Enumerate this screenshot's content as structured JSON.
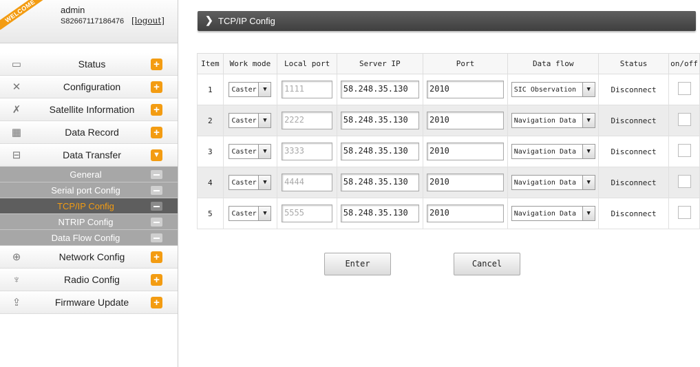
{
  "user": {
    "welcome": "WELCOME",
    "name": "admin",
    "serial": "S82667117186476",
    "logout": "[logout]"
  },
  "nav_top": [
    {
      "label": "Status",
      "icon": "monitor-icon",
      "glyph": "▭"
    },
    {
      "label": "Configuration",
      "icon": "tools-icon",
      "glyph": "✕"
    },
    {
      "label": "Satellite Information",
      "icon": "satellite-icon",
      "glyph": "✗"
    },
    {
      "label": "Data Record",
      "icon": "calendar-icon",
      "glyph": "▦"
    },
    {
      "label": "Data Transfer",
      "icon": "network-icon",
      "glyph": "⊟"
    }
  ],
  "nav_sub": [
    {
      "label": "General"
    },
    {
      "label": "Serial port Config"
    },
    {
      "label": "TCP/IP Config",
      "active": true
    },
    {
      "label": "NTRIP Config"
    },
    {
      "label": "Data Flow Config"
    }
  ],
  "nav_bottom": [
    {
      "label": "Network Config",
      "icon": "globe-icon",
      "glyph": "⊕"
    },
    {
      "label": "Radio Config",
      "icon": "antenna-icon",
      "glyph": "♆"
    },
    {
      "label": "Firmware Update",
      "icon": "upload-icon",
      "glyph": "⇪"
    }
  ],
  "header": {
    "title": "TCP/IP Config"
  },
  "table": {
    "columns": [
      "Item",
      "Work mode",
      "Local port",
      "Server IP",
      "Port",
      "Data flow",
      "Status",
      "on/off"
    ],
    "rows": [
      {
        "item": "1",
        "mode": "Caster",
        "local_port": "1111",
        "server_ip": "58.248.35.130",
        "port": "2010",
        "data_flow": "SIC Observation",
        "status": "Disconnect"
      },
      {
        "item": "2",
        "mode": "Caster",
        "local_port": "2222",
        "server_ip": "58.248.35.130",
        "port": "2010",
        "data_flow": "Navigation Data",
        "status": "Disconnect"
      },
      {
        "item": "3",
        "mode": "Caster",
        "local_port": "3333",
        "server_ip": "58.248.35.130",
        "port": "2010",
        "data_flow": "Navigation Data",
        "status": "Disconnect"
      },
      {
        "item": "4",
        "mode": "Caster",
        "local_port": "4444",
        "server_ip": "58.248.35.130",
        "port": "2010",
        "data_flow": "Navigation Data",
        "status": "Disconnect"
      },
      {
        "item": "5",
        "mode": "Caster",
        "local_port": "5555",
        "server_ip": "58.248.35.130",
        "port": "2010",
        "data_flow": "Navigation Data",
        "status": "Disconnect"
      }
    ]
  },
  "buttons": {
    "enter": "Enter",
    "cancel": "Cancel"
  },
  "colors": {
    "accent": "#f39c12",
    "header_bar": "#4a4a4a",
    "submenu": "#a7a7a7",
    "submenu_active": "#5e5e5e"
  }
}
